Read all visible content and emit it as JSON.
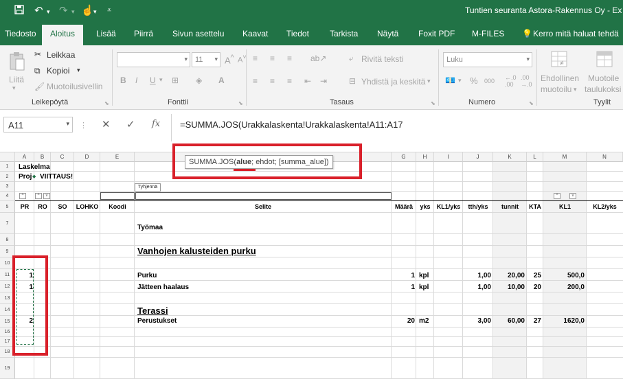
{
  "titlebar": {
    "title": "Tuntien seuranta Astora-Rakennus Oy  -  Ex",
    "quick_access": [
      "save-icon",
      "undo-icon",
      "redo-icon",
      "touch-mode-icon",
      "customize-icon"
    ]
  },
  "tabs": [
    {
      "label": "Tiedosto"
    },
    {
      "label": "Aloitus"
    },
    {
      "label": "Lisää"
    },
    {
      "label": "Piirrä"
    },
    {
      "label": "Sivun asettelu"
    },
    {
      "label": "Kaavat"
    },
    {
      "label": "Tiedot"
    },
    {
      "label": "Tarkista"
    },
    {
      "label": "Näytä"
    },
    {
      "label": "Foxit PDF"
    },
    {
      "label": "M-FILES"
    },
    {
      "label": "Kerro mitä haluat tehdä"
    }
  ],
  "ribbon": {
    "clipboard": {
      "label": "Leikepöytä",
      "paste": "Liitä",
      "cut": "Leikkaa",
      "copy": "Kopioi",
      "format_painter": "Muotoilusivellin"
    },
    "font": {
      "label": "Fonttii",
      "font_name": "",
      "font_size": "11",
      "bold": "B",
      "italic": "I",
      "underline": "U"
    },
    "alignment": {
      "label": "Tasaus",
      "wrap": "Rivitä teksti",
      "merge": "Yhdistä ja keskitä"
    },
    "number": {
      "label": "Numero",
      "format": "Luku",
      "percent": "%",
      "comma": "000"
    },
    "styles": {
      "label": "Tyylit",
      "conditional": "Ehdollinen",
      "conditional2": "muotoilu",
      "table": "Muotoile",
      "table2": "taulukoksi"
    }
  },
  "formula_bar": {
    "name_box": "A11",
    "fx": "fx",
    "formula": "=SUMMA.JOS(Urakkalaskenta!Urakkalaskenta!A11:A17"
  },
  "tooltip": {
    "func": "SUMMA.JOS(",
    "arg_bold": "alue",
    "rest": "; ehdot; [summa_alue])"
  },
  "columns": [
    "A",
    "B",
    "C",
    "D",
    "E",
    "G",
    "H",
    "I",
    "J",
    "K",
    "L",
    "M",
    "N"
  ],
  "rows": [
    "1",
    "2",
    "3",
    "4",
    "5",
    "7",
    "8",
    "9",
    "10",
    "11",
    "12",
    "13",
    "14",
    "15",
    "16",
    "17",
    "18",
    "19"
  ],
  "sheet": {
    "title1": "Laskelma",
    "title2a": "Proj",
    "title2b": "VIITTAUS!",
    "clear_label": "Tyhjennä",
    "headers": [
      "PR",
      "RO",
      "SO",
      "LOHKO",
      "Koodi",
      "Selite",
      "Määrä",
      "yks",
      "KL1/yks",
      "tth/yks",
      "tunnit",
      "KTA",
      "KL1",
      "KL2/yks"
    ],
    "section1": "Työmaa",
    "section2": "Vanhojen kalusteiden purku",
    "row11": {
      "pr": "1",
      "selite": "Purku",
      "maara": "1",
      "yks": "kpl",
      "tth": "1,00",
      "tunnit": "20,00",
      "kta": "25",
      "kl1": "500,0"
    },
    "row12": {
      "pr": "1",
      "selite": "Jätteen haalaus",
      "maara": "1",
      "yks": "kpl",
      "tth": "1,00",
      "tunnit": "10,00",
      "kta": "20",
      "kl1": "200,0"
    },
    "section3": "Terassi",
    "row15": {
      "pr": "2",
      "selite": "Perustukset",
      "maara": "20",
      "yks": "m2",
      "tth": "3,00",
      "tunnit": "60,00",
      "kta": "27",
      "kl1": "1620,0"
    }
  },
  "colors": {
    "excel_green": "#217346",
    "highlight_red": "#d9202a"
  }
}
